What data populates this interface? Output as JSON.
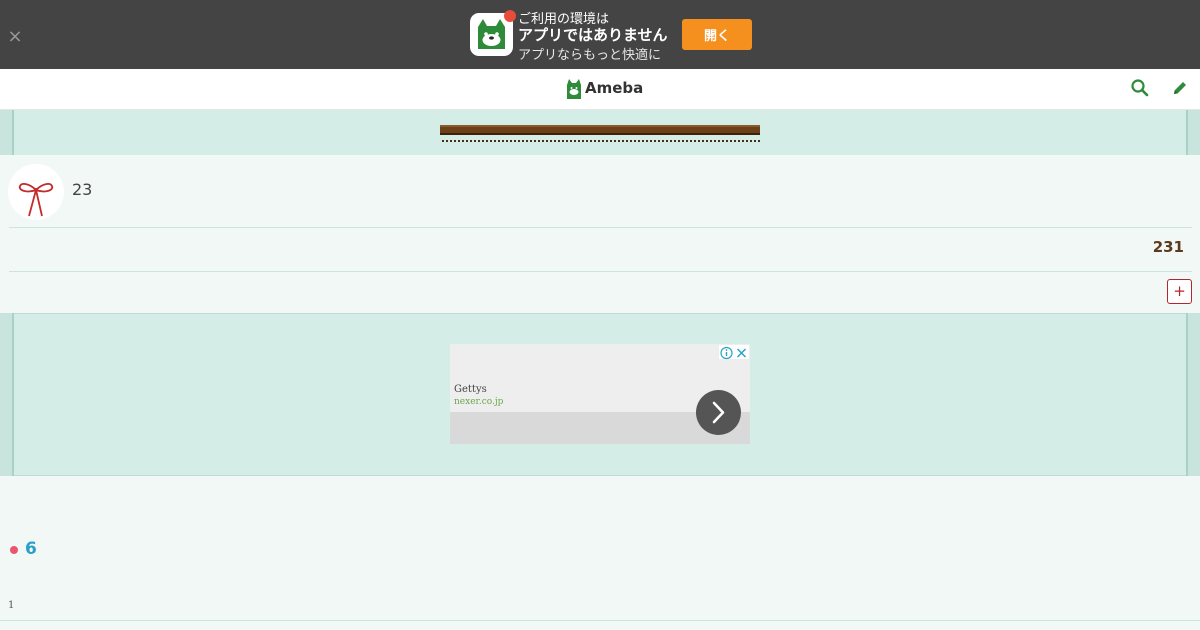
{
  "banner": {
    "close": "×",
    "line1": "ご利用の環境は",
    "line2": "アプリではありません",
    "line3": "アプリならもっと快適に",
    "open_label": "開く"
  },
  "header": {
    "logo": "Ameba",
    "search_icon": "search-icon",
    "edit_icon": "pencil-icon"
  },
  "profile": {
    "count": "23",
    "followers": "231",
    "expand": "+"
  },
  "ad": {
    "title": "Gettys",
    "domain": "nexer.co.jp"
  },
  "entry": {
    "number": "6",
    "small": "1"
  },
  "colors": {
    "banner_bg": "#444444",
    "open_button": "#f5901e",
    "ameba_green": "#2e8b3a",
    "panel_bg": "#f1f8f6",
    "band_bg": "#d4ede7",
    "accent_red": "#b3262e",
    "entry_blue": "#2a9fc9"
  }
}
